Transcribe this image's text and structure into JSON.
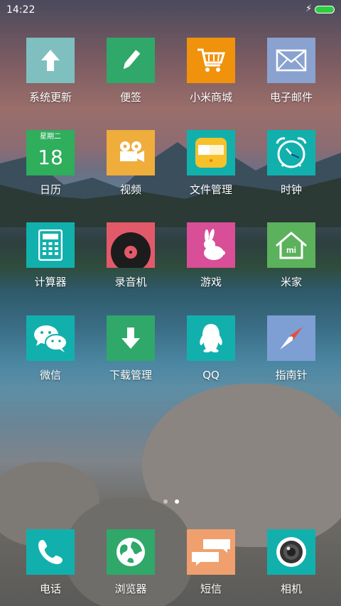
{
  "status_bar": {
    "time": "14:22"
  },
  "apps": {
    "system_update": {
      "label": "系统更新",
      "color": "#7fbfbf"
    },
    "notes": {
      "label": "便签",
      "color": "#2fa86a"
    },
    "mi_store": {
      "label": "小米商城",
      "color": "#f0920c"
    },
    "email": {
      "label": "电子邮件",
      "color": "#8aa2cf"
    },
    "calendar": {
      "label": "日历",
      "color": "#2fae5c",
      "weekday": "星期二",
      "day": "18"
    },
    "video": {
      "label": "视频",
      "color": "#efad3c"
    },
    "file_manager": {
      "label": "文件管理",
      "color": "#12b0ad"
    },
    "clock": {
      "label": "时钟",
      "color": "#12b0ad"
    },
    "calculator": {
      "label": "计算器",
      "color": "#12b0ad"
    },
    "recorder": {
      "label": "录音机",
      "color": "#e25a6a"
    },
    "games": {
      "label": "游戏",
      "color": "#d84e97"
    },
    "mi_home": {
      "label": "米家",
      "color": "#5bb15c"
    },
    "wechat": {
      "label": "微信",
      "color": "#12b0ad"
    },
    "download_manager": {
      "label": "下载管理",
      "color": "#2fa86a"
    },
    "qq": {
      "label": "QQ",
      "color": "#12b0ad"
    },
    "compass": {
      "label": "指南针",
      "color": "#7d9fd4"
    }
  },
  "dock": {
    "phone": {
      "label": "电话",
      "color": "#12b0ad"
    },
    "browser": {
      "label": "浏览器",
      "color": "#2fa86a"
    },
    "messages": {
      "label": "短信",
      "color": "#efa06e"
    },
    "camera": {
      "label": "相机",
      "color": "#12b0ad"
    }
  },
  "pager": {
    "pages": 2,
    "current": 2
  }
}
